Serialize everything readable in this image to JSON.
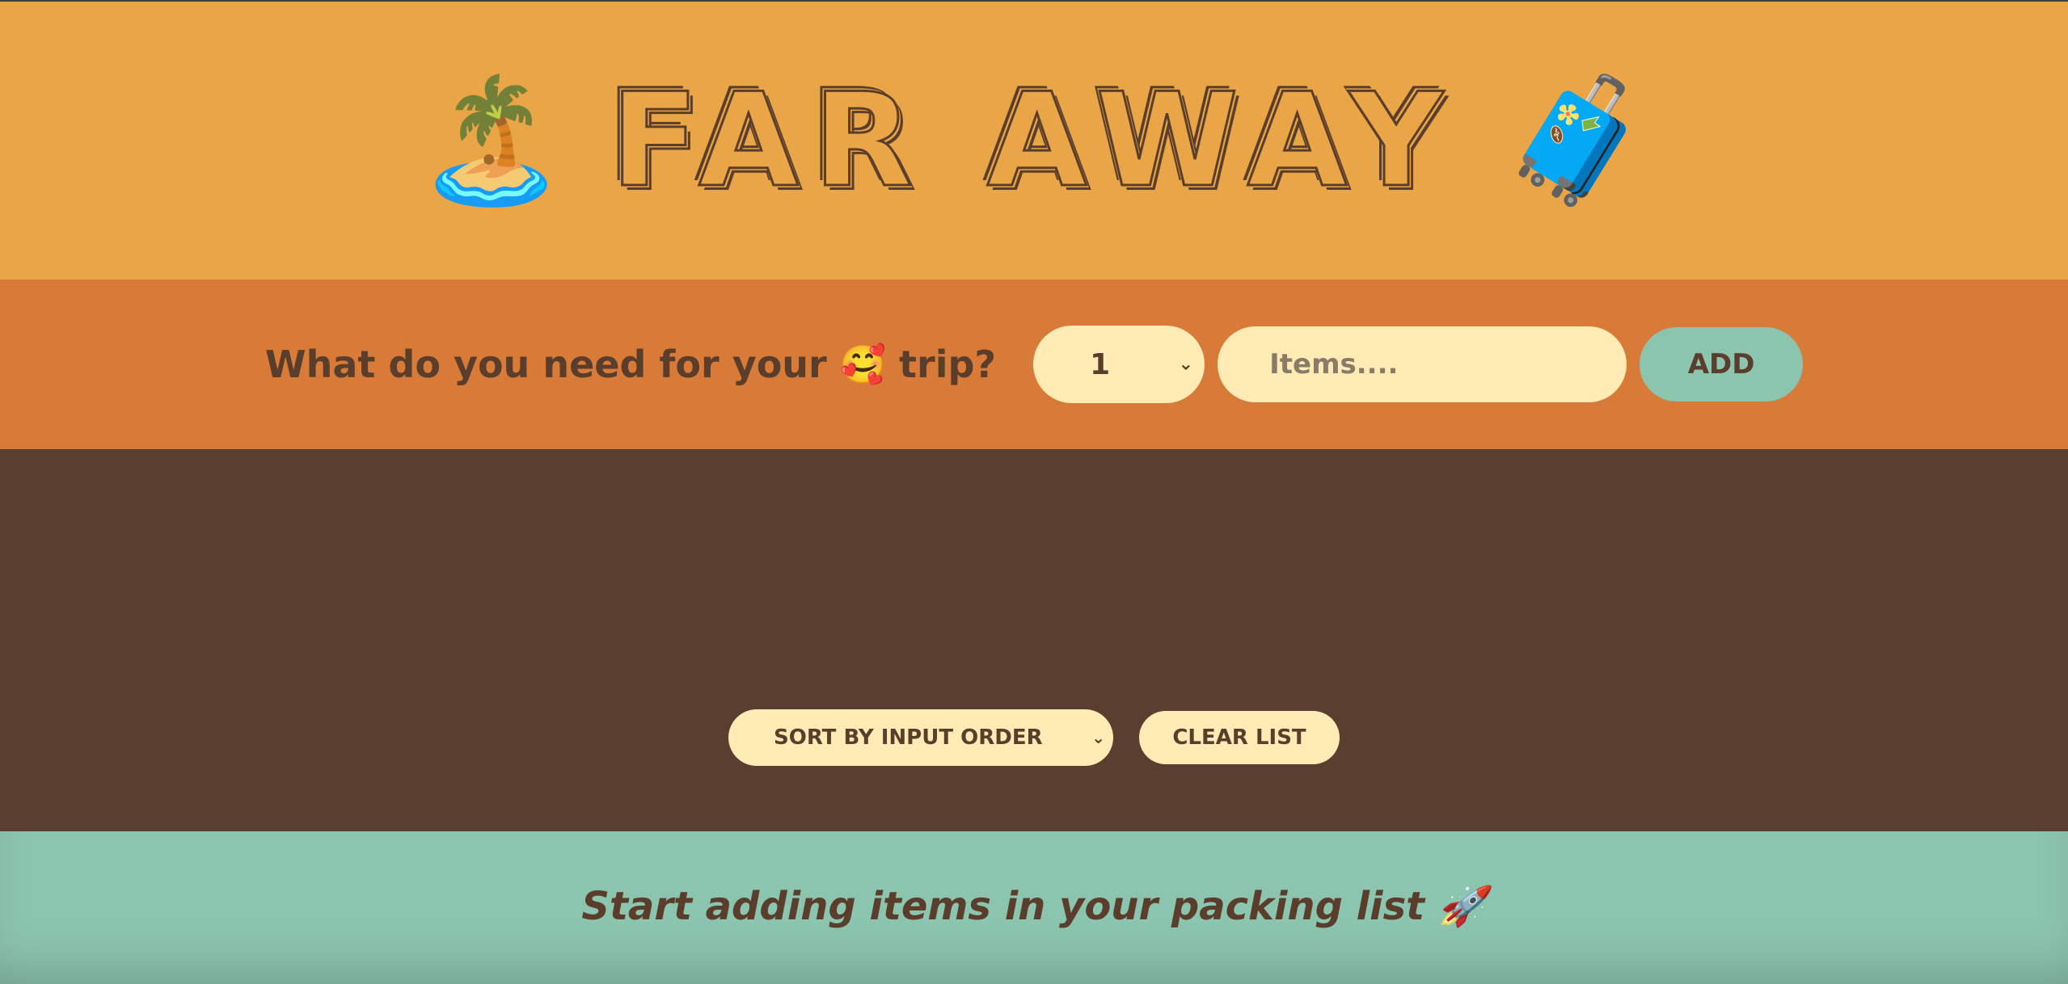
{
  "header": {
    "left_icon": "🏝️",
    "title": "FAR AWAY",
    "right_icon": "🧳"
  },
  "form": {
    "prompt": "What do you need for your 🥰 trip?",
    "quantity_value": "1",
    "item_placeholder": "Items....",
    "item_value": "",
    "add_label": "ADD"
  },
  "list": {
    "items": [],
    "sort_value": "SORT BY INPUT ORDER",
    "clear_label": "CLEAR LIST"
  },
  "stats": {
    "message": "Start adding items in your packing list 🚀"
  },
  "colors": {
    "header_bg": "#e9a546",
    "form_bg": "#d97b38",
    "list_bg": "#5a3e2f",
    "stats_bg": "#8bc4af",
    "text": "#5a3e2b",
    "field_bg": "#ffebb3"
  }
}
